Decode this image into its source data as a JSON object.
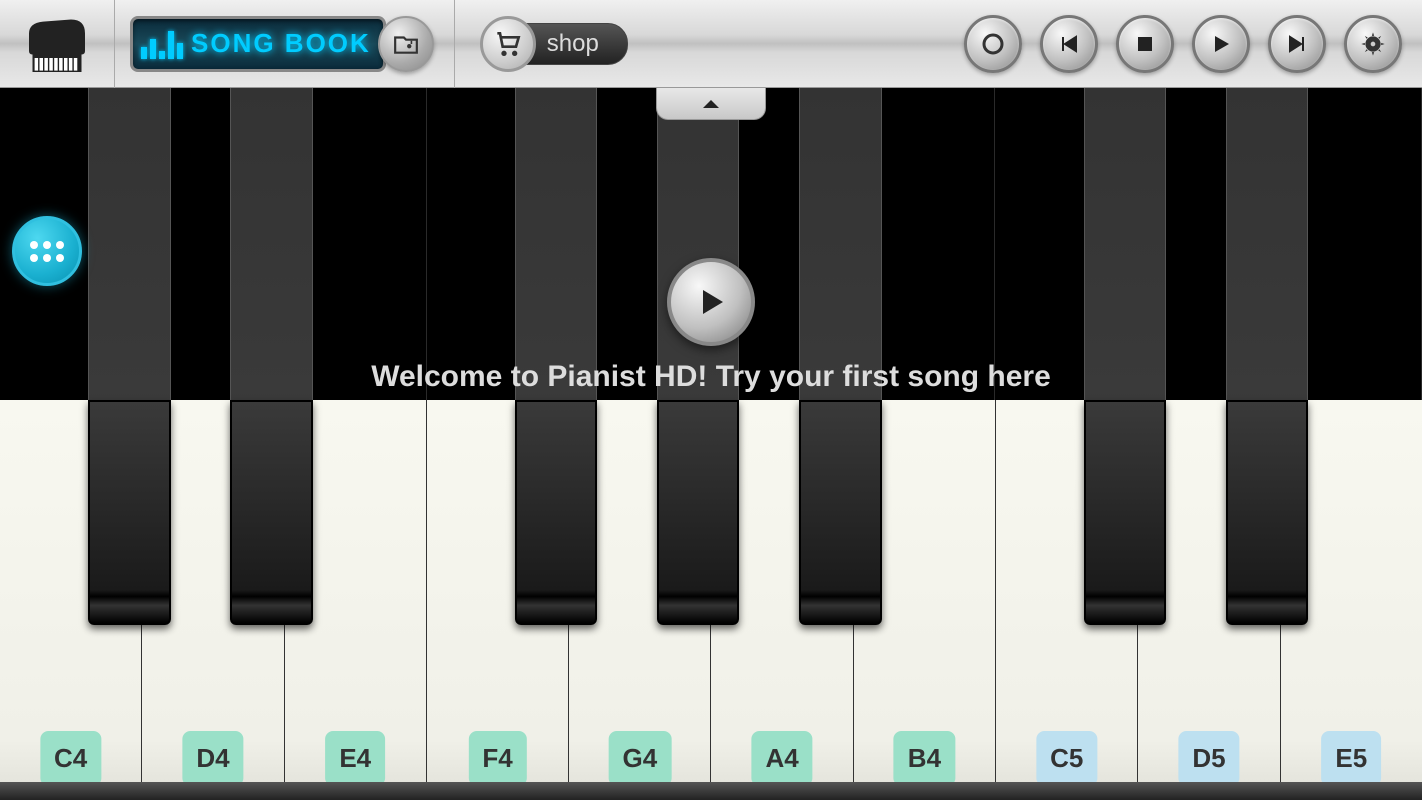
{
  "toolbar": {
    "songbook_label": "SONG BOOK",
    "shop_label": "shop"
  },
  "main": {
    "welcome_text": "Welcome to Pianist HD! Try your first song here"
  },
  "keys": {
    "white": [
      {
        "label": "C4",
        "color": "green"
      },
      {
        "label": "D4",
        "color": "green"
      },
      {
        "label": "E4",
        "color": "green"
      },
      {
        "label": "F4",
        "color": "green"
      },
      {
        "label": "G4",
        "color": "green"
      },
      {
        "label": "A4",
        "color": "green"
      },
      {
        "label": "B4",
        "color": "green"
      },
      {
        "label": "C5",
        "color": "blue"
      },
      {
        "label": "D5",
        "color": "blue"
      },
      {
        "label": "E5",
        "color": "blue"
      }
    ],
    "black_positions": [
      {
        "note": "C#4",
        "left_pct": 6.2
      },
      {
        "note": "D#4",
        "left_pct": 16.2
      },
      {
        "note": "F#4",
        "left_pct": 36.2
      },
      {
        "note": "G#4",
        "left_pct": 46.2
      },
      {
        "note": "A#4",
        "left_pct": 56.2
      },
      {
        "note": "C#5",
        "left_pct": 76.2
      },
      {
        "note": "D#5",
        "left_pct": 86.2
      }
    ]
  }
}
